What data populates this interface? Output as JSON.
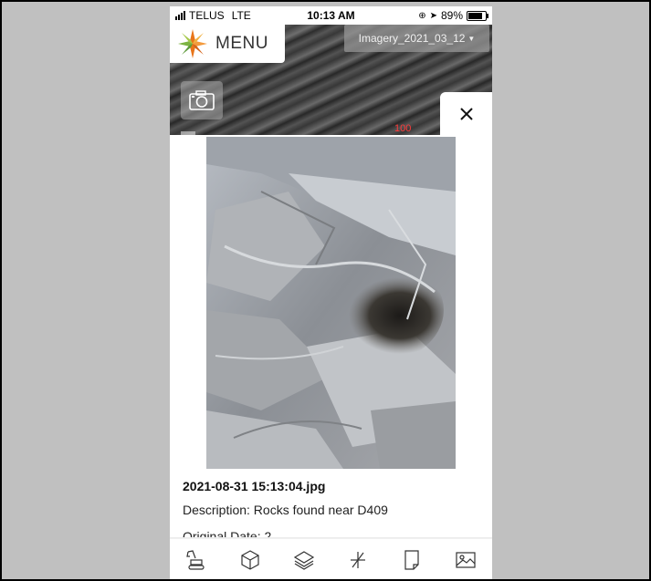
{
  "status_bar": {
    "carrier": "TELUS",
    "network": "LTE",
    "time": "10:13 AM",
    "battery": "89%"
  },
  "header": {
    "menu_label": "MENU",
    "imagery_selected": "Imagery_2021_03_12"
  },
  "map": {
    "scale_label": "100"
  },
  "photo_popup": {
    "filename": "2021-08-31 15:13:04.jpg",
    "description": "Description: Rocks found near D409",
    "original_date": "Original Date: 2"
  },
  "toolbar": {
    "tools": [
      "excavator-icon",
      "cube-icon",
      "layers-icon",
      "measure-icon",
      "document-icon",
      "image-icon"
    ]
  },
  "colors": {
    "logo_orange": "#e8751a",
    "logo_green": "#7cb342",
    "scale_red": "#ff3b3b"
  }
}
